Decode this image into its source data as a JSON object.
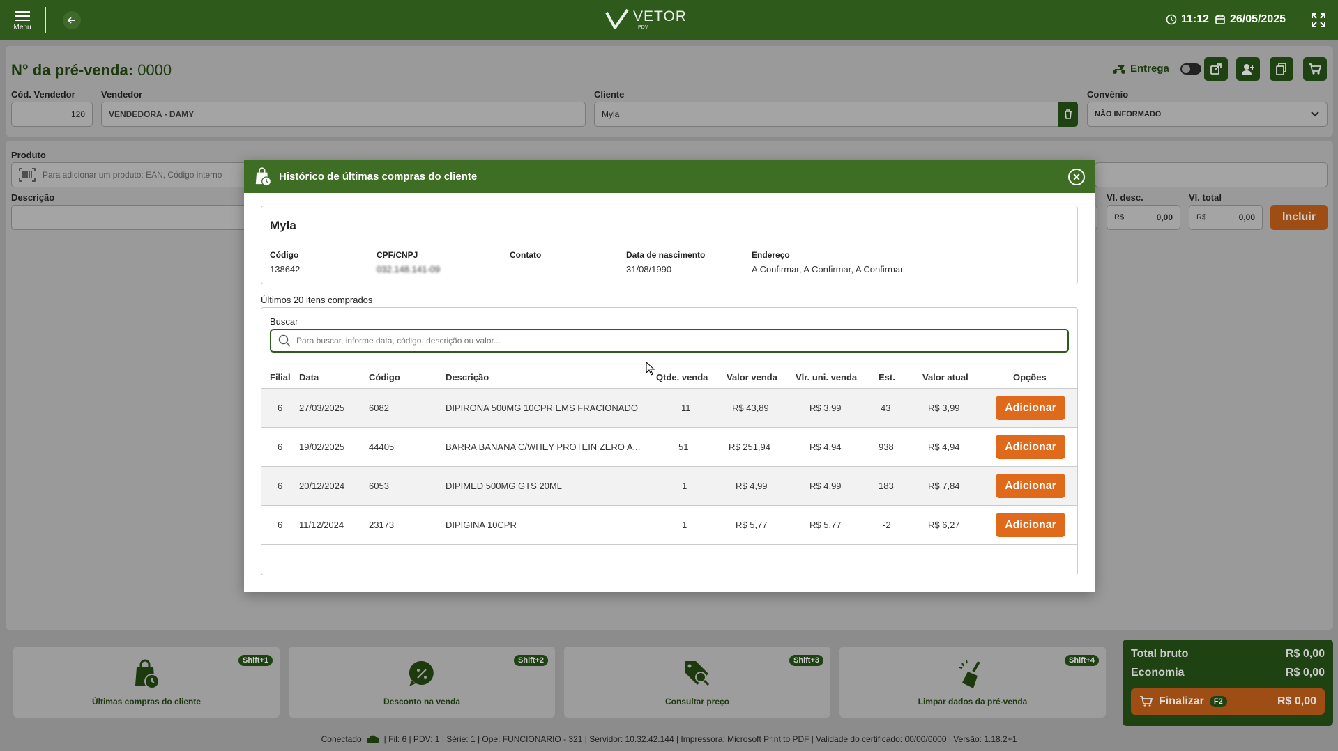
{
  "topbar": {
    "menu_label": "Menu",
    "logo_text": "VETOR",
    "logo_sub": "PDV",
    "time": "11:12",
    "date": "26/05/2025"
  },
  "header": {
    "title_label": "N° da pré-venda:",
    "title_number": "0000",
    "entrega_label": "Entrega",
    "cod_vendedor_label": "Cód. Vendedor",
    "cod_vendedor_value": "120",
    "vendedor_label": "Vendedor",
    "vendedor_value": "VENDEDORA - DAMY",
    "cliente_label": "Cliente",
    "cliente_value": "Myla",
    "convenio_label": "Convênio",
    "convenio_value": "NÃO INFORMADO"
  },
  "product": {
    "produto_label": "Produto",
    "produto_placeholder": "Para adicionar um produto: EAN, Código interno",
    "descricao_label": "Descrição",
    "vl_desc_label": "Vl. desc.",
    "vl_desc_currency": "R$",
    "vl_desc_value": "0,00",
    "vl_total_label": "Vl. total",
    "vl_total_currency": "R$",
    "vl_total_value": "0,00",
    "incluir_label": "Incluir"
  },
  "modal": {
    "title": "Histórico de últimas compras do cliente",
    "client_name": "Myla",
    "fields": {
      "codigo_label": "Código",
      "codigo_value": "138642",
      "cpf_label": "CPF/CNPJ",
      "cpf_value": "032.148.141-09",
      "contato_label": "Contato",
      "contato_value": "-",
      "nascimento_label": "Data de nascimento",
      "nascimento_value": "31/08/1990",
      "endereco_label": "Endereço",
      "endereco_value": "A Confirmar, A Confirmar, A Confirmar"
    },
    "subtitle": "Últimos 20 itens comprados",
    "buscar_label": "Buscar",
    "search_placeholder": "Para buscar, informe data, código, descrição ou valor...",
    "columns": [
      "Filial",
      "Data",
      "Código",
      "Descrição",
      "Qtde. venda",
      "Valor venda",
      "Vlr. uni. venda",
      "Est.",
      "Valor atual",
      "Opções"
    ],
    "add_label": "Adicionar",
    "rows": [
      {
        "filial": "6",
        "data": "27/03/2025",
        "codigo": "6082",
        "descricao": "DIPIRONA 500MG  10CPR EMS FRACIONADO",
        "qtde": "11",
        "valor_venda": "R$ 43,89",
        "vlr_uni": "R$ 3,99",
        "est": "43",
        "valor_atual": "R$ 3,99"
      },
      {
        "filial": "6",
        "data": "19/02/2025",
        "codigo": "44405",
        "descricao": "BARRA BANANA C/WHEY PROTEIN ZERO A...",
        "qtde": "51",
        "valor_venda": "R$ 251,94",
        "vlr_uni": "R$ 4,94",
        "est": "938",
        "valor_atual": "R$ 4,94"
      },
      {
        "filial": "6",
        "data": "20/12/2024",
        "codigo": "6053",
        "descricao": "DIPIMED 500MG GTS 20ML",
        "qtde": "1",
        "valor_venda": "R$ 4,99",
        "vlr_uni": "R$ 4,99",
        "est": "183",
        "valor_atual": "R$ 7,84"
      },
      {
        "filial": "6",
        "data": "11/12/2024",
        "codigo": "23173",
        "descricao": "DIPIGINA 10CPR",
        "qtde": "1",
        "valor_venda": "R$ 5,77",
        "vlr_uni": "R$ 5,77",
        "est": "-2",
        "valor_atual": "R$ 6,27"
      }
    ]
  },
  "footer_buttons": [
    {
      "label": "Últimas compras do cliente",
      "shortcut": "Shift+1",
      "icon": "bag-clock-icon"
    },
    {
      "label": "Desconto na venda",
      "shortcut": "Shift+2",
      "icon": "discount-icon"
    },
    {
      "label": "Consultar preço",
      "shortcut": "Shift+3",
      "icon": "price-tag-search-icon"
    },
    {
      "label": "Limpar dados da pré-venda",
      "shortcut": "Shift+4",
      "icon": "broom-icon"
    }
  ],
  "totals": {
    "total_bruto_label": "Total bruto",
    "total_bruto_value": "R$ 0,00",
    "economia_label": "Economia",
    "economia_value": "R$ 0,00",
    "finalizar_label": "Finalizar",
    "finalizar_shortcut": "F2",
    "finalizar_value": "R$ 0,00"
  },
  "status": {
    "conectado": "Conectado",
    "details": "| Fil: 6 | PDV: 1 | Série: 1 | Ope: FUNCIONARIO - 321 | Servidor: 10.32.42.144 | Impressora: Microsoft Print to PDF | Validade do certificado: 00/00/0000 | Versão: 1.18.2+1"
  },
  "colors": {
    "primary_green": "#2e5a1c",
    "accent_orange": "#e06a1b"
  }
}
